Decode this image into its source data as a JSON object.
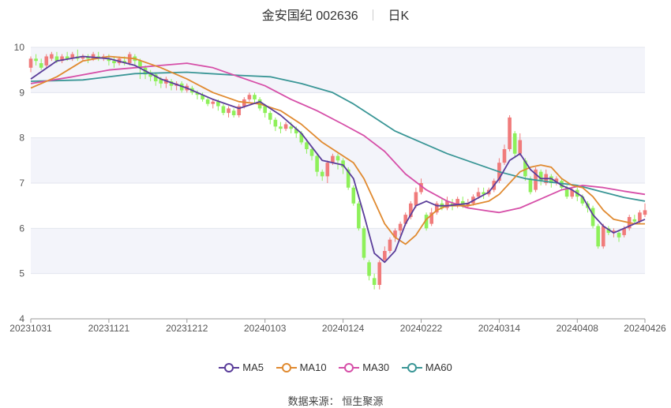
{
  "header": {
    "title": "金安国纪 002636",
    "period_tab": "日K"
  },
  "source": {
    "label": "数据来源：",
    "name": "恒生聚源"
  },
  "colors": {
    "up": "#f07b7b",
    "down": "#8ef05a",
    "ma5": "#5a3d9a",
    "ma10": "#e08a30",
    "ma30": "#d64fa8",
    "ma60": "#3a9696",
    "band": "#f3f4fa",
    "grid": "#e3e6ef"
  },
  "chart_data": {
    "type": "candlestick",
    "ylim": [
      4,
      10
    ],
    "y_ticks": [
      "4",
      "5",
      "6",
      "7",
      "8",
      "9",
      "10"
    ],
    "x_ticks": [
      "20231031",
      "20231121",
      "20231212",
      "20240103",
      "20240124",
      "20240222",
      "20240314",
      "20240408",
      "20240426"
    ],
    "x_tick_index": [
      0,
      15,
      30,
      45,
      60,
      75,
      90,
      105,
      118
    ],
    "n_days": 119,
    "legend": [
      "MA5",
      "MA10",
      "MA30",
      "MA60"
    ],
    "candles": [
      [
        9.55,
        9.75,
        9.8,
        9.45
      ],
      [
        9.75,
        9.7,
        9.85,
        9.6
      ],
      [
        9.65,
        9.55,
        9.75,
        9.5
      ],
      [
        9.6,
        9.8,
        9.85,
        9.55
      ],
      [
        9.75,
        9.85,
        9.9,
        9.7
      ],
      [
        9.8,
        9.7,
        9.9,
        9.65
      ],
      [
        9.7,
        9.8,
        9.85,
        9.65
      ],
      [
        9.8,
        9.75,
        9.9,
        9.7
      ],
      [
        9.75,
        9.85,
        9.9,
        9.7
      ],
      [
        9.8,
        9.75,
        9.95,
        9.7
      ],
      [
        9.75,
        9.8,
        9.85,
        9.7
      ],
      [
        9.8,
        9.75,
        9.85,
        9.65
      ],
      [
        9.75,
        9.85,
        9.9,
        9.7
      ],
      [
        9.8,
        9.75,
        9.9,
        9.7
      ],
      [
        9.75,
        9.8,
        9.85,
        9.7
      ],
      [
        9.75,
        9.7,
        9.85,
        9.6
      ],
      [
        9.7,
        9.65,
        9.8,
        9.55
      ],
      [
        9.65,
        9.75,
        9.8,
        9.6
      ],
      [
        9.7,
        9.65,
        9.8,
        9.6
      ],
      [
        9.65,
        9.85,
        9.9,
        9.6
      ],
      [
        9.8,
        9.7,
        9.85,
        9.6
      ],
      [
        9.7,
        9.55,
        9.75,
        9.3
      ],
      [
        9.55,
        9.4,
        9.6,
        9.3
      ],
      [
        9.45,
        9.35,
        9.5,
        9.25
      ],
      [
        9.4,
        9.25,
        9.45,
        9.15
      ],
      [
        9.3,
        9.2,
        9.35,
        9.1
      ],
      [
        9.2,
        9.3,
        9.35,
        9.1
      ],
      [
        9.25,
        9.15,
        9.3,
        9.05
      ],
      [
        9.15,
        9.2,
        9.25,
        9.05
      ],
      [
        9.2,
        9.05,
        9.25,
        9.0
      ],
      [
        9.05,
        9.15,
        9.2,
        9.0
      ],
      [
        9.1,
        9.0,
        9.15,
        8.95
      ],
      [
        9.0,
        8.95,
        9.05,
        8.85
      ],
      [
        8.95,
        8.85,
        9.0,
        8.8
      ],
      [
        8.85,
        8.75,
        8.9,
        8.7
      ],
      [
        8.75,
        8.8,
        8.85,
        8.65
      ],
      [
        8.8,
        8.7,
        8.85,
        8.6
      ],
      [
        8.7,
        8.55,
        8.75,
        8.5
      ],
      [
        8.55,
        8.65,
        8.7,
        8.45
      ],
      [
        8.6,
        8.5,
        8.65,
        8.45
      ],
      [
        8.5,
        8.7,
        8.75,
        8.45
      ],
      [
        8.7,
        8.85,
        8.9,
        8.65
      ],
      [
        8.85,
        8.95,
        9.0,
        8.8
      ],
      [
        8.95,
        8.85,
        9.0,
        8.75
      ],
      [
        8.85,
        8.65,
        8.9,
        8.6
      ],
      [
        8.7,
        8.55,
        8.75,
        8.45
      ],
      [
        8.55,
        8.4,
        8.6,
        8.3
      ],
      [
        8.4,
        8.25,
        8.45,
        8.15
      ],
      [
        8.25,
        8.2,
        8.35,
        8.1
      ],
      [
        8.2,
        8.3,
        8.35,
        8.15
      ],
      [
        8.25,
        8.2,
        8.35,
        8.1
      ],
      [
        8.2,
        8.1,
        8.25,
        8.0
      ],
      [
        8.1,
        7.9,
        8.15,
        7.85
      ],
      [
        7.9,
        7.75,
        7.95,
        7.65
      ],
      [
        7.75,
        7.6,
        7.8,
        7.5
      ],
      [
        7.6,
        7.25,
        7.65,
        7.15
      ],
      [
        7.25,
        7.15,
        7.3,
        7.05
      ],
      [
        7.15,
        7.45,
        7.5,
        7.0
      ],
      [
        7.45,
        7.6,
        7.65,
        7.4
      ],
      [
        7.6,
        7.5,
        7.65,
        7.3
      ],
      [
        7.5,
        7.35,
        7.55,
        7.2
      ],
      [
        7.3,
        6.9,
        7.35,
        6.85
      ],
      [
        6.9,
        6.55,
        6.95,
        6.5
      ],
      [
        6.55,
        6.0,
        6.6,
        5.95
      ],
      [
        6.0,
        5.35,
        6.05,
        5.3
      ],
      [
        5.25,
        4.95,
        5.3,
        4.85
      ],
      [
        4.9,
        4.75,
        5.0,
        4.65
      ],
      [
        4.75,
        5.25,
        5.3,
        4.65
      ],
      [
        5.3,
        5.5,
        5.6,
        5.25
      ],
      [
        5.5,
        5.75,
        5.8,
        5.45
      ],
      [
        5.8,
        5.95,
        6.0,
        5.7
      ],
      [
        5.95,
        6.1,
        6.15,
        5.85
      ],
      [
        6.1,
        6.3,
        6.35,
        6.05
      ],
      [
        6.25,
        6.55,
        6.6,
        6.2
      ],
      [
        6.5,
        6.8,
        6.9,
        6.45
      ],
      [
        6.8,
        7.0,
        7.1,
        6.75
      ],
      [
        6.3,
        6.0,
        6.35,
        5.95
      ],
      [
        6.1,
        6.35,
        6.45,
        6.05
      ],
      [
        6.35,
        6.55,
        6.6,
        6.3
      ],
      [
        6.55,
        6.45,
        6.65,
        6.4
      ],
      [
        6.45,
        6.6,
        6.7,
        6.4
      ],
      [
        6.55,
        6.5,
        6.65,
        6.4
      ],
      [
        6.5,
        6.65,
        6.7,
        6.45
      ],
      [
        6.6,
        6.5,
        6.7,
        6.45
      ],
      [
        6.5,
        6.55,
        6.65,
        6.45
      ],
      [
        6.55,
        6.7,
        6.75,
        6.5
      ],
      [
        6.7,
        6.8,
        6.9,
        6.65
      ],
      [
        6.8,
        6.75,
        6.9,
        6.65
      ],
      [
        6.75,
        6.85,
        6.9,
        6.7
      ],
      [
        6.85,
        7.05,
        7.1,
        6.8
      ],
      [
        7.05,
        7.45,
        7.55,
        7.0
      ],
      [
        7.45,
        7.75,
        7.85,
        7.4
      ],
      [
        7.75,
        8.45,
        8.5,
        7.7
      ],
      [
        8.1,
        7.65,
        8.15,
        7.55
      ],
      [
        7.65,
        7.95,
        8.1,
        7.6
      ],
      [
        7.5,
        7.15,
        7.55,
        7.05
      ],
      [
        7.1,
        6.8,
        7.15,
        6.75
      ],
      [
        6.85,
        7.3,
        7.35,
        6.8
      ],
      [
        7.25,
        7.05,
        7.3,
        6.95
      ],
      [
        7.0,
        7.2,
        7.3,
        6.95
      ],
      [
        7.15,
        7.0,
        7.2,
        6.9
      ],
      [
        7.0,
        7.1,
        7.15,
        6.95
      ],
      [
        7.05,
        6.9,
        7.1,
        6.85
      ],
      [
        6.9,
        6.7,
        6.95,
        6.65
      ],
      [
        6.7,
        6.85,
        6.9,
        6.65
      ],
      [
        6.85,
        6.7,
        6.9,
        6.6
      ],
      [
        6.7,
        6.55,
        6.75,
        6.5
      ],
      [
        6.55,
        6.45,
        6.6,
        6.35
      ],
      [
        6.45,
        6.05,
        6.5,
        6.0
      ],
      [
        6.05,
        5.6,
        6.1,
        5.55
      ],
      [
        5.6,
        6.05,
        6.1,
        5.55
      ],
      [
        6.0,
        5.9,
        6.05,
        5.85
      ],
      [
        5.9,
        5.95,
        6.0,
        5.8
      ],
      [
        5.9,
        5.8,
        5.95,
        5.7
      ],
      [
        5.85,
        6.0,
        6.05,
        5.8
      ],
      [
        6.0,
        6.25,
        6.3,
        5.95
      ],
      [
        6.2,
        6.15,
        6.3,
        6.1
      ],
      [
        6.15,
        6.35,
        6.4,
        6.1
      ],
      [
        6.3,
        6.4,
        6.55,
        6.25
      ]
    ],
    "ma5": [
      [
        0,
        9.3
      ],
      [
        5,
        9.7
      ],
      [
        10,
        9.8
      ],
      [
        15,
        9.75
      ],
      [
        20,
        9.6
      ],
      [
        25,
        9.3
      ],
      [
        30,
        9.1
      ],
      [
        35,
        8.85
      ],
      [
        40,
        8.65
      ],
      [
        44,
        8.8
      ],
      [
        48,
        8.5
      ],
      [
        52,
        8.1
      ],
      [
        56,
        7.5
      ],
      [
        60,
        7.4
      ],
      [
        62,
        7.1
      ],
      [
        64,
        6.3
      ],
      [
        66,
        5.45
      ],
      [
        68,
        5.25
      ],
      [
        70,
        5.5
      ],
      [
        72,
        6.1
      ],
      [
        74,
        6.5
      ],
      [
        76,
        6.6
      ],
      [
        78,
        6.5
      ],
      [
        80,
        6.5
      ],
      [
        84,
        6.55
      ],
      [
        88,
        6.8
      ],
      [
        90,
        7.1
      ],
      [
        92,
        7.5
      ],
      [
        94,
        7.65
      ],
      [
        96,
        7.3
      ],
      [
        98,
        7.1
      ],
      [
        100,
        7.1
      ],
      [
        102,
        6.95
      ],
      [
        104,
        6.85
      ],
      [
        106,
        6.7
      ],
      [
        108,
        6.3
      ],
      [
        110,
        6.05
      ],
      [
        112,
        5.9
      ],
      [
        114,
        6.0
      ],
      [
        116,
        6.1
      ],
      [
        118,
        6.2
      ]
    ],
    "ma10": [
      [
        0,
        9.1
      ],
      [
        5,
        9.35
      ],
      [
        10,
        9.7
      ],
      [
        15,
        9.8
      ],
      [
        20,
        9.75
      ],
      [
        25,
        9.55
      ],
      [
        30,
        9.3
      ],
      [
        35,
        9.0
      ],
      [
        40,
        8.8
      ],
      [
        44,
        8.75
      ],
      [
        48,
        8.6
      ],
      [
        52,
        8.3
      ],
      [
        56,
        7.9
      ],
      [
        60,
        7.6
      ],
      [
        62,
        7.45
      ],
      [
        64,
        7.1
      ],
      [
        66,
        6.6
      ],
      [
        68,
        6.1
      ],
      [
        70,
        5.8
      ],
      [
        72,
        5.65
      ],
      [
        74,
        5.85
      ],
      [
        76,
        6.2
      ],
      [
        78,
        6.4
      ],
      [
        80,
        6.5
      ],
      [
        84,
        6.5
      ],
      [
        88,
        6.6
      ],
      [
        90,
        6.75
      ],
      [
        92,
        7.0
      ],
      [
        94,
        7.25
      ],
      [
        96,
        7.35
      ],
      [
        98,
        7.4
      ],
      [
        100,
        7.35
      ],
      [
        102,
        7.1
      ],
      [
        104,
        6.95
      ],
      [
        106,
        6.9
      ],
      [
        108,
        6.7
      ],
      [
        110,
        6.4
      ],
      [
        112,
        6.2
      ],
      [
        114,
        6.15
      ],
      [
        116,
        6.1
      ],
      [
        118,
        6.1
      ]
    ],
    "ma30": [
      [
        0,
        9.2
      ],
      [
        8,
        9.35
      ],
      [
        15,
        9.5
      ],
      [
        20,
        9.55
      ],
      [
        25,
        9.6
      ],
      [
        30,
        9.65
      ],
      [
        35,
        9.55
      ],
      [
        40,
        9.35
      ],
      [
        45,
        9.15
      ],
      [
        50,
        8.85
      ],
      [
        55,
        8.6
      ],
      [
        60,
        8.3
      ],
      [
        64,
        8.05
      ],
      [
        68,
        7.7
      ],
      [
        72,
        7.2
      ],
      [
        76,
        6.85
      ],
      [
        80,
        6.6
      ],
      [
        84,
        6.45
      ],
      [
        88,
        6.38
      ],
      [
        90,
        6.35
      ],
      [
        94,
        6.45
      ],
      [
        98,
        6.65
      ],
      [
        102,
        6.85
      ],
      [
        106,
        6.95
      ],
      [
        110,
        6.9
      ],
      [
        114,
        6.82
      ],
      [
        118,
        6.75
      ]
    ],
    "ma60": [
      [
        0,
        9.25
      ],
      [
        10,
        9.28
      ],
      [
        20,
        9.42
      ],
      [
        30,
        9.45
      ],
      [
        40,
        9.38
      ],
      [
        46,
        9.35
      ],
      [
        52,
        9.2
      ],
      [
        58,
        9.0
      ],
      [
        62,
        8.75
      ],
      [
        66,
        8.45
      ],
      [
        70,
        8.15
      ],
      [
        75,
        7.9
      ],
      [
        80,
        7.65
      ],
      [
        85,
        7.45
      ],
      [
        90,
        7.25
      ],
      [
        95,
        7.1
      ],
      [
        100,
        7.02
      ],
      [
        105,
        6.95
      ],
      [
        110,
        6.8
      ],
      [
        114,
        6.68
      ],
      [
        118,
        6.6
      ]
    ]
  }
}
